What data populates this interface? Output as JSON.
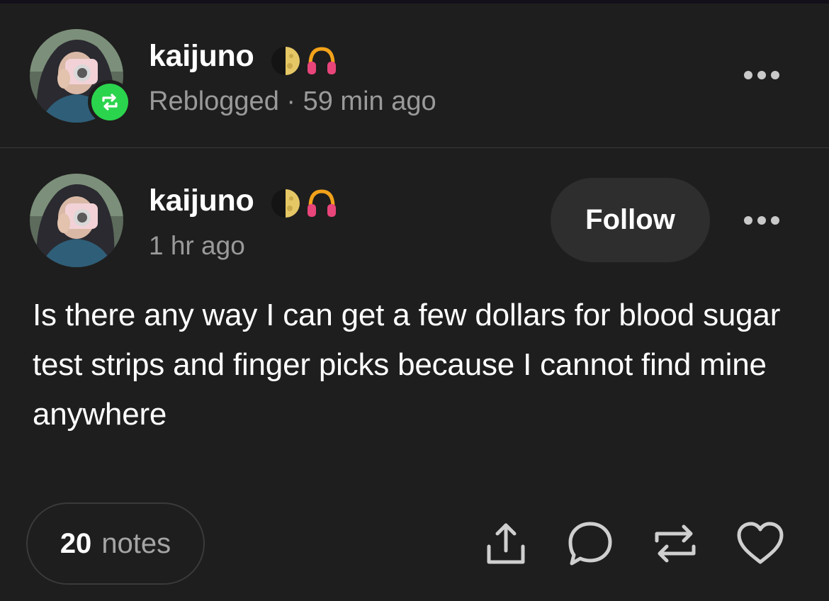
{
  "reblog_header": {
    "username": "kaijuno",
    "status": "Reblogged",
    "separator": " · ",
    "time": "59 min ago",
    "badges": [
      "moon-icon",
      "headphones-icon"
    ]
  },
  "post": {
    "username": "kaijuno",
    "time": "1 hr ago",
    "follow_label": "Follow",
    "body": "Is there any way I can get a few dollars for blood sugar test strips and finger picks because I cannot find mine anywhere",
    "badges": [
      "moon-icon",
      "headphones-icon"
    ]
  },
  "footer": {
    "notes_count": "20",
    "notes_label": "notes",
    "actions": [
      "share-icon",
      "reply-icon",
      "reblog-icon",
      "like-icon"
    ]
  },
  "colors": {
    "background": "#1e1e1e",
    "reblog_green": "#2bd44d",
    "muted_text": "#9a9a9a",
    "follow_bg": "#2e2e2e",
    "headphones_pink": "#e8457a",
    "headphones_band": "#f2a21a"
  }
}
